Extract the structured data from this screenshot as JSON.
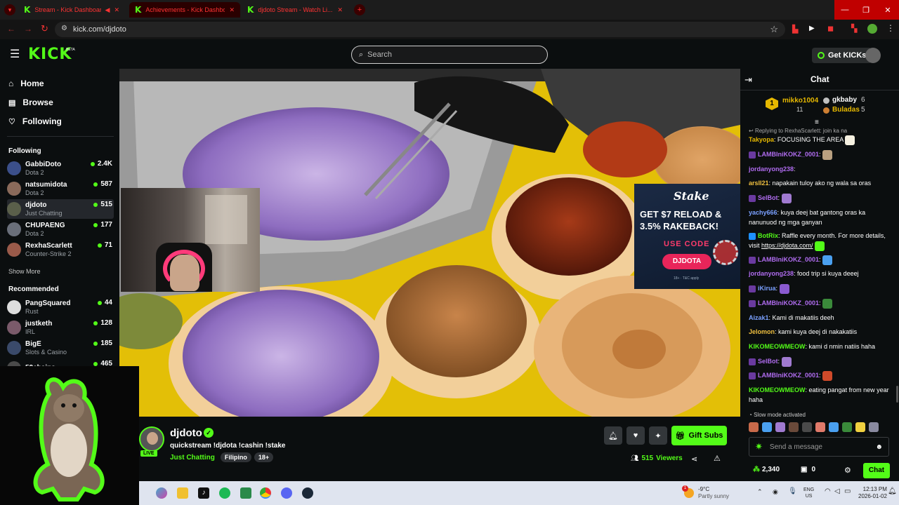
{
  "browser": {
    "tabs": [
      {
        "title": "Stream - Kick Dashboard"
      },
      {
        "title": "Achievements - Kick Dashboard"
      },
      {
        "title": "djdoto Stream - Watch Li..."
      }
    ],
    "url": "kick.com/djdoto"
  },
  "header": {
    "logo": "KICK",
    "logo_beta": "BETA",
    "search_placeholder": "Search",
    "get_kicks_label": "Get KICKs"
  },
  "sidebar": {
    "nav": [
      {
        "label": "Home",
        "icon": "home-icon"
      },
      {
        "label": "Browse",
        "icon": "browse-icon"
      },
      {
        "label": "Following",
        "icon": "heart-icon"
      }
    ],
    "following_heading": "Following",
    "following": [
      {
        "name": "GabbiDoto",
        "category": "Dota 2",
        "viewers": "2.4K",
        "color": "#3b4f8a"
      },
      {
        "name": "natsumidota",
        "category": "Dota 2",
        "viewers": "587",
        "color": "#8a6a5a"
      },
      {
        "name": "djdoto",
        "category": "Just Chatting",
        "viewers": "515",
        "color": "#5a5f4a"
      },
      {
        "name": "CHUPAENG",
        "category": "Dota 2",
        "viewers": "177",
        "color": "#6a6f7a"
      },
      {
        "name": "RexhaScarlett",
        "category": "Counter-Strike 2",
        "viewers": "71",
        "color": "#9a5a4a"
      }
    ],
    "show_more": "Show More",
    "recommended_heading": "Recommended",
    "recommended": [
      {
        "name": "PangSquared",
        "category": "Rust",
        "viewers": "44",
        "color": "#ddd"
      },
      {
        "name": "justketh",
        "category": "IRL",
        "viewers": "128",
        "color": "#7a5a6a"
      },
      {
        "name": "BigE",
        "category": "Slots & Casino",
        "viewers": "185",
        "color": "#3a4a6a"
      },
      {
        "name": "52chains",
        "category": "",
        "viewers": "465",
        "color": "#4a4a4a"
      }
    ]
  },
  "ad": {
    "brand": "Stake",
    "headline1": "GET $7 RELOAD &",
    "headline2": "3.5% RAKEBACK!",
    "use_code": "USE CODE",
    "code": "DJDOTA",
    "fine": "18+ · T&C apply"
  },
  "stream": {
    "name": "djdoto",
    "title": "quickstream !djdota !cashin !stake",
    "category": "Just Chatting",
    "tags": [
      "Filipino",
      "18+"
    ],
    "live_label": "LIVE",
    "viewers": "515",
    "viewers_label": "Viewers",
    "gift_subs_label": "Gift Subs"
  },
  "chat": {
    "title": "Chat",
    "leaderboard": {
      "first": {
        "rank": "1",
        "name": "mikko1004",
        "count": "11"
      },
      "second": {
        "name": "gkbaby",
        "count": "6"
      },
      "third": {
        "name": "Buladas",
        "count": "5"
      }
    },
    "reply_context": "Replying to RexhaScarlett: join ka na",
    "messages": [
      {
        "user": "Takyopa",
        "color": "#e6b800",
        "text": "FOCUSING THE AREA"
      },
      {
        "user": "LAMBIniKOKZ_0001",
        "color": "#b06cf0",
        "text": ""
      },
      {
        "user": "jordanyong238",
        "color": "#b06cf0",
        "text": ""
      },
      {
        "user": "arsll21",
        "color": "#f0c040",
        "text": "napakain tuloy ako ng wala sa oras"
      },
      {
        "user": "SelBot",
        "color": "#b06cf0",
        "text": ""
      },
      {
        "user": "yachy666",
        "color": "#7aa0ff",
        "text": "kuya deej bat gantong oras ka nanunuod ng mga ganyan"
      },
      {
        "user": "BotRix",
        "color": "#53fc18",
        "text": "Raffle every month. For more details, visit"
      },
      {
        "user": "LAMBIniKOKZ_0001",
        "color": "#b06cf0",
        "text": ""
      },
      {
        "user": "jordanyong238",
        "color": "#b06cf0",
        "text": "food trip si kuya deeej"
      },
      {
        "user": "iKirua",
        "color": "#7aa0ff",
        "text": ""
      },
      {
        "user": "LAMBIniKOKZ_0001",
        "color": "#b06cf0",
        "text": ""
      },
      {
        "user": "Aizak1",
        "color": "#7aa0ff",
        "text": "Kami di makatiis deeh"
      },
      {
        "user": "Jelomon",
        "color": "#f0c040",
        "text": "kami kuya deej di nakakatiis"
      },
      {
        "user": "KIKOMEOWMEOW",
        "color": "#53fc18",
        "text": "kami d nmin natiis haha"
      },
      {
        "user": "SelBot",
        "color": "#b06cf0",
        "text": ""
      },
      {
        "user": "LAMBIniKOKZ_0001",
        "color": "#b06cf0",
        "text": ""
      },
      {
        "user": "KIKOMEOWMEOW",
        "color": "#53fc18",
        "text": "eating pangat from new year haha"
      }
    ],
    "botrix_link": "https://djdota.com/",
    "slow_mode": "Slow mode activated",
    "input_placeholder": "Send a message",
    "points": "2,340",
    "gifts": "0",
    "send_label": "Chat"
  },
  "taskbar": {
    "weather_temp": "-9°C",
    "weather_desc": "Partly sunny",
    "weather_alert": "1",
    "lang1": "ENG",
    "lang2": "US",
    "time": "12:13 PM",
    "date": "2026-01-02"
  }
}
